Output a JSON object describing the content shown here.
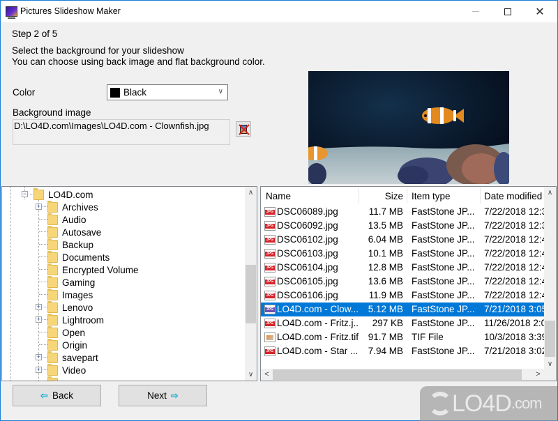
{
  "window": {
    "title": "Pictures Slideshow Maker",
    "controls": {
      "minimize": "minimize",
      "maximize": "maximize",
      "close": "close"
    }
  },
  "wizard": {
    "step": "Step 2 of 5",
    "instruction_line1": "Select the background for your slideshow",
    "instruction_line2": "You can choose using back image and flat background color."
  },
  "color": {
    "label": "Color",
    "selected": "Black",
    "swatch": "#000000"
  },
  "background_image": {
    "label": "Background image",
    "path": "D:\\LO4D.com\\Images\\LO4D.com - Clownfish.jpg",
    "clear_button_icon": "remove-image-icon"
  },
  "preview": {
    "description": "Clownfish aquarium preview"
  },
  "folder_tree": {
    "root": "LO4D.com",
    "items": [
      {
        "label": "Archives",
        "expandable": true
      },
      {
        "label": "Audio",
        "expandable": false
      },
      {
        "label": "Autosave",
        "expandable": false
      },
      {
        "label": "Backup",
        "expandable": false
      },
      {
        "label": "Documents",
        "expandable": false
      },
      {
        "label": "Encrypted Volume",
        "expandable": false
      },
      {
        "label": "Gaming",
        "expandable": false
      },
      {
        "label": "Images",
        "expandable": false
      },
      {
        "label": "Lenovo",
        "expandable": true
      },
      {
        "label": "Lightroom",
        "expandable": true
      },
      {
        "label": "Open",
        "expandable": false
      },
      {
        "label": "Origin",
        "expandable": false
      },
      {
        "label": "savepart",
        "expandable": true
      },
      {
        "label": "Video",
        "expandable": true
      }
    ]
  },
  "file_list": {
    "columns": [
      "Name",
      "Size",
      "Item type",
      "Date modified"
    ],
    "rows": [
      {
        "name": "DSC06089.jpg",
        "size": "11.7 MB",
        "type": "FastStone JP...",
        "date": "7/22/2018 12:3",
        "icon": "jpg",
        "selected": false
      },
      {
        "name": "DSC06092.jpg",
        "size": "13.5 MB",
        "type": "FastStone JP...",
        "date": "7/22/2018 12:3",
        "icon": "jpg",
        "selected": false
      },
      {
        "name": "DSC06102.jpg",
        "size": "6.04 MB",
        "type": "FastStone JP...",
        "date": "7/22/2018 12:4",
        "icon": "jpg",
        "selected": false
      },
      {
        "name": "DSC06103.jpg",
        "size": "10.1 MB",
        "type": "FastStone JP...",
        "date": "7/22/2018 12:4",
        "icon": "jpg",
        "selected": false
      },
      {
        "name": "DSC06104.jpg",
        "size": "12.8 MB",
        "type": "FastStone JP...",
        "date": "7/22/2018 12:4",
        "icon": "jpg",
        "selected": false
      },
      {
        "name": "DSC06105.jpg",
        "size": "13.6 MB",
        "type": "FastStone JP...",
        "date": "7/22/2018 12:4",
        "icon": "jpg",
        "selected": false
      },
      {
        "name": "DSC06106.jpg",
        "size": "11.9 MB",
        "type": "FastStone JP...",
        "date": "7/22/2018 12:4",
        "icon": "jpg",
        "selected": false
      },
      {
        "name": "LO4D.com - Clow...",
        "size": "5.12 MB",
        "type": "FastStone JP...",
        "date": "7/21/2018 3:05",
        "icon": "jpg",
        "selected": true
      },
      {
        "name": "LO4D.com - Fritz.j...",
        "size": "297 KB",
        "type": "FastStone JP...",
        "date": "11/26/2018 2:0",
        "icon": "jpg",
        "selected": false
      },
      {
        "name": "LO4D.com - Fritz.tif",
        "size": "91.7 MB",
        "type": "TIF File",
        "date": "10/3/2018 3:39",
        "icon": "tif",
        "selected": false
      },
      {
        "name": "LO4D.com - Star ...",
        "size": "7.94 MB",
        "type": "FastStone JP...",
        "date": "7/21/2018 3:02",
        "icon": "jpg",
        "selected": false
      }
    ]
  },
  "buttons": {
    "back": "Back",
    "next": "Next",
    "back_arrow": "⇦",
    "next_arrow": "⇨"
  },
  "watermark": {
    "text": "LO4D",
    "suffix": ".com"
  },
  "jpg_badge": "JPG",
  "accent_color": "#0078d7"
}
